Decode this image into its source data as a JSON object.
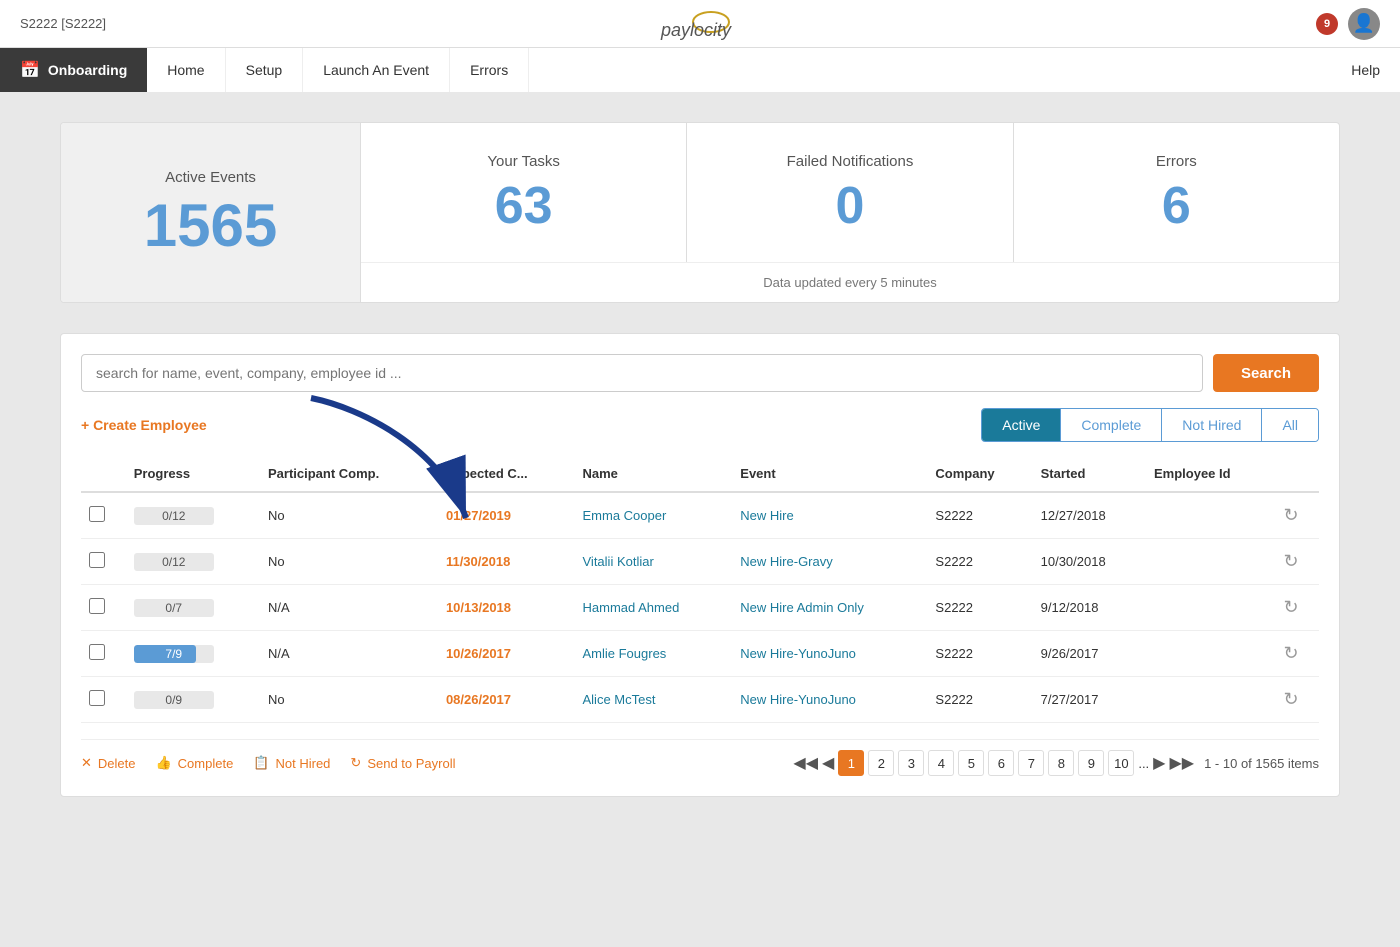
{
  "topbar": {
    "company": "S2222 [S2222]",
    "logo_text": "paylocity",
    "notif_count": "9",
    "help": "Help"
  },
  "nav": {
    "module": "Onboarding",
    "links": [
      "Home",
      "Setup",
      "Launch An Event",
      "Errors"
    ],
    "help": "Help"
  },
  "stats": {
    "active_events_label": "Active Events",
    "active_events_value": "1565",
    "your_tasks_label": "Your Tasks",
    "your_tasks_value": "63",
    "failed_label": "Failed Notifications",
    "failed_value": "0",
    "errors_label": "Errors",
    "errors_value": "6",
    "data_updated": "Data updated every 5 minutes"
  },
  "search": {
    "placeholder": "search for name, event, company, employee id ...",
    "button_label": "Search"
  },
  "create_employee": "+ Create Employee",
  "filter_tabs": [
    "Active",
    "Complete",
    "Not Hired",
    "All"
  ],
  "active_filter": "Active",
  "table": {
    "headers": [
      "",
      "Progress",
      "Participant Comp.",
      "Expected C...",
      "Name",
      "Event",
      "Company",
      "Started",
      "Employee Id",
      ""
    ],
    "rows": [
      {
        "progress": "0/12",
        "progress_pct": 0,
        "participant": "No",
        "expected": "01/27/2019",
        "name": "Emma Cooper",
        "event": "New Hire",
        "company": "S2222",
        "started": "12/27/2018",
        "emp_id": ""
      },
      {
        "progress": "0/12",
        "progress_pct": 0,
        "participant": "No",
        "expected": "11/30/2018",
        "name": "Vitalii Kotliar",
        "event": "New Hire-Gravy",
        "company": "S2222",
        "started": "10/30/2018",
        "emp_id": ""
      },
      {
        "progress": "0/7",
        "progress_pct": 0,
        "participant": "N/A",
        "expected": "10/13/2018",
        "name": "Hammad Ahmed",
        "event": "New Hire Admin Only",
        "company": "S2222",
        "started": "9/12/2018",
        "emp_id": ""
      },
      {
        "progress": "7/9",
        "progress_pct": 78,
        "participant": "N/A",
        "expected": "10/26/2017",
        "name": "Amlie Fougres",
        "event": "New Hire-YunoJuno",
        "company": "S2222",
        "started": "9/26/2017",
        "emp_id": ""
      },
      {
        "progress": "0/9",
        "progress_pct": 0,
        "participant": "No",
        "expected": "08/26/2017",
        "name": "Alice McTest",
        "event": "New Hire-YunoJuno",
        "company": "S2222",
        "started": "7/27/2017",
        "emp_id": ""
      }
    ]
  },
  "bottom_actions": {
    "delete": "Delete",
    "complete": "Complete",
    "not_hired": "Not Hired",
    "send_to_payroll": "Send to Payroll"
  },
  "pagination": {
    "pages": [
      1,
      2,
      3,
      4,
      5,
      6,
      7,
      8,
      9,
      10
    ],
    "active_page": 1,
    "total_info": "1 - 10 of 1565 items"
  }
}
